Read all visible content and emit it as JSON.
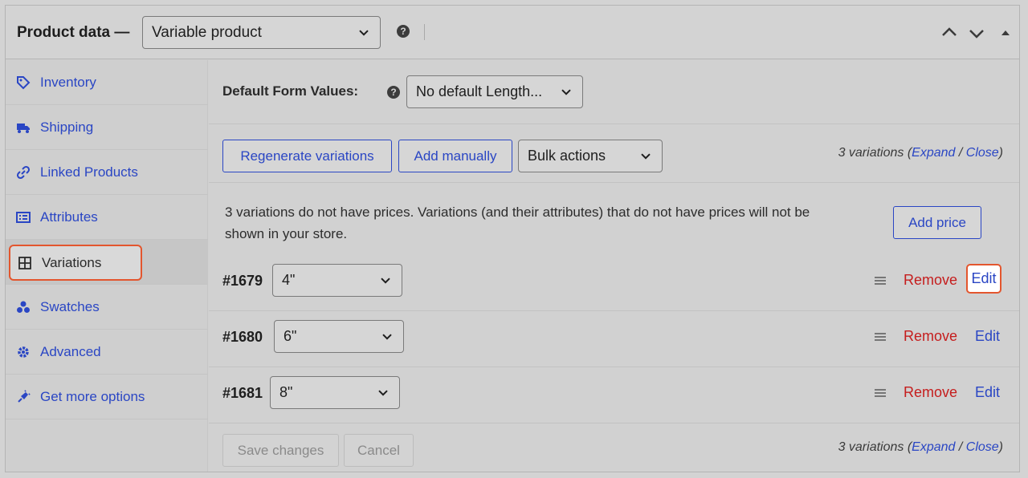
{
  "header": {
    "title": "Product data —",
    "product_type": "Variable product",
    "help": "?"
  },
  "sidebar": {
    "items": [
      {
        "label": "Inventory",
        "icon": "tag-icon"
      },
      {
        "label": "Shipping",
        "icon": "truck-icon"
      },
      {
        "label": "Linked Products",
        "icon": "link-icon"
      },
      {
        "label": "Attributes",
        "icon": "list-icon"
      },
      {
        "label": "Variations",
        "icon": "grid-icon",
        "active": true
      },
      {
        "label": "Swatches",
        "icon": "swatches-icon"
      },
      {
        "label": "Advanced",
        "icon": "gear-icon"
      },
      {
        "label": "Get more options",
        "icon": "plug-icon"
      }
    ]
  },
  "main": {
    "default_form_label": "Default Form Values:",
    "default_form_value": "No default Length...",
    "regenerate_label": "Regenerate variations",
    "add_manually_label": "Add manually",
    "bulk_actions_label": "Bulk actions",
    "count_text": "3 variations (",
    "expand_label": "Expand",
    "slash": " / ",
    "close_label": "Close",
    "close_paren": ")",
    "notice_line1": "3 variations do not have prices. Variations (and their attributes) that do not have prices will not be",
    "notice_line2": "shown in your store.",
    "add_price_label": "Add price",
    "variations": [
      {
        "id": "#1679",
        "value": "4\"",
        "remove": "Remove",
        "edit": "Edit"
      },
      {
        "id": "#1680",
        "value": "6\"",
        "remove": "Remove",
        "edit": "Edit"
      },
      {
        "id": "#1681",
        "value": "8\"",
        "remove": "Remove",
        "edit": "Edit"
      }
    ],
    "save_label": "Save changes",
    "cancel_label": "Cancel"
  },
  "colors": {
    "accent": "#2a46c4",
    "danger": "#c51d1d",
    "highlight": "#e3562e"
  }
}
